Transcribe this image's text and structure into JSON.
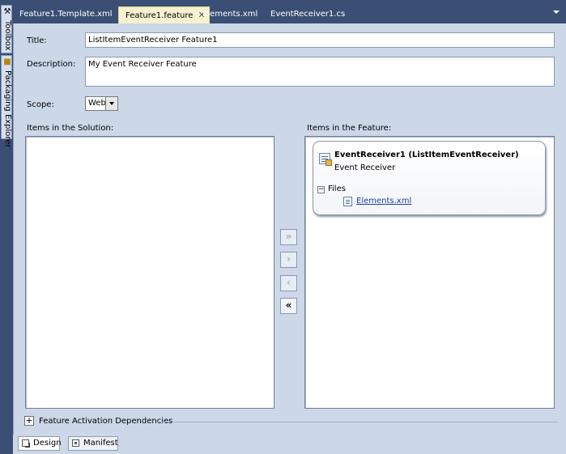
{
  "side_panel": {
    "toolbox_label": "Toolbox",
    "packaging_label": "Packaging Explorer"
  },
  "tabs": [
    {
      "label": "Feature1.Template.xml",
      "active": false
    },
    {
      "label": "Feature1.feature",
      "active": true
    },
    {
      "label": "Elements.xml",
      "active": false
    },
    {
      "label": "EventReceiver1.cs",
      "active": false
    }
  ],
  "form": {
    "title_label": "Title:",
    "title_value": "ListItemEventReceiver Feature1",
    "description_label": "Description:",
    "description_value": "My Event Receiver Feature",
    "scope_label": "Scope:",
    "scope_value": "Web"
  },
  "solution_items": {
    "label": "Items in the Solution:"
  },
  "feature_items": {
    "label": "Items in the Feature:",
    "item_title": "EventReceiver1 (ListItemEventReceiver)",
    "item_type": "Event Receiver",
    "files_label": "Files",
    "file_name": "Elements.xml"
  },
  "move_buttons": {
    "add_all": "»",
    "add": "›",
    "remove": "‹",
    "remove_all": "«"
  },
  "dependencies": {
    "label": "Feature Activation Dependencies"
  },
  "bottom_tabs": [
    {
      "label": "Design",
      "active": true
    },
    {
      "label": "Manifest",
      "active": false
    }
  ]
}
